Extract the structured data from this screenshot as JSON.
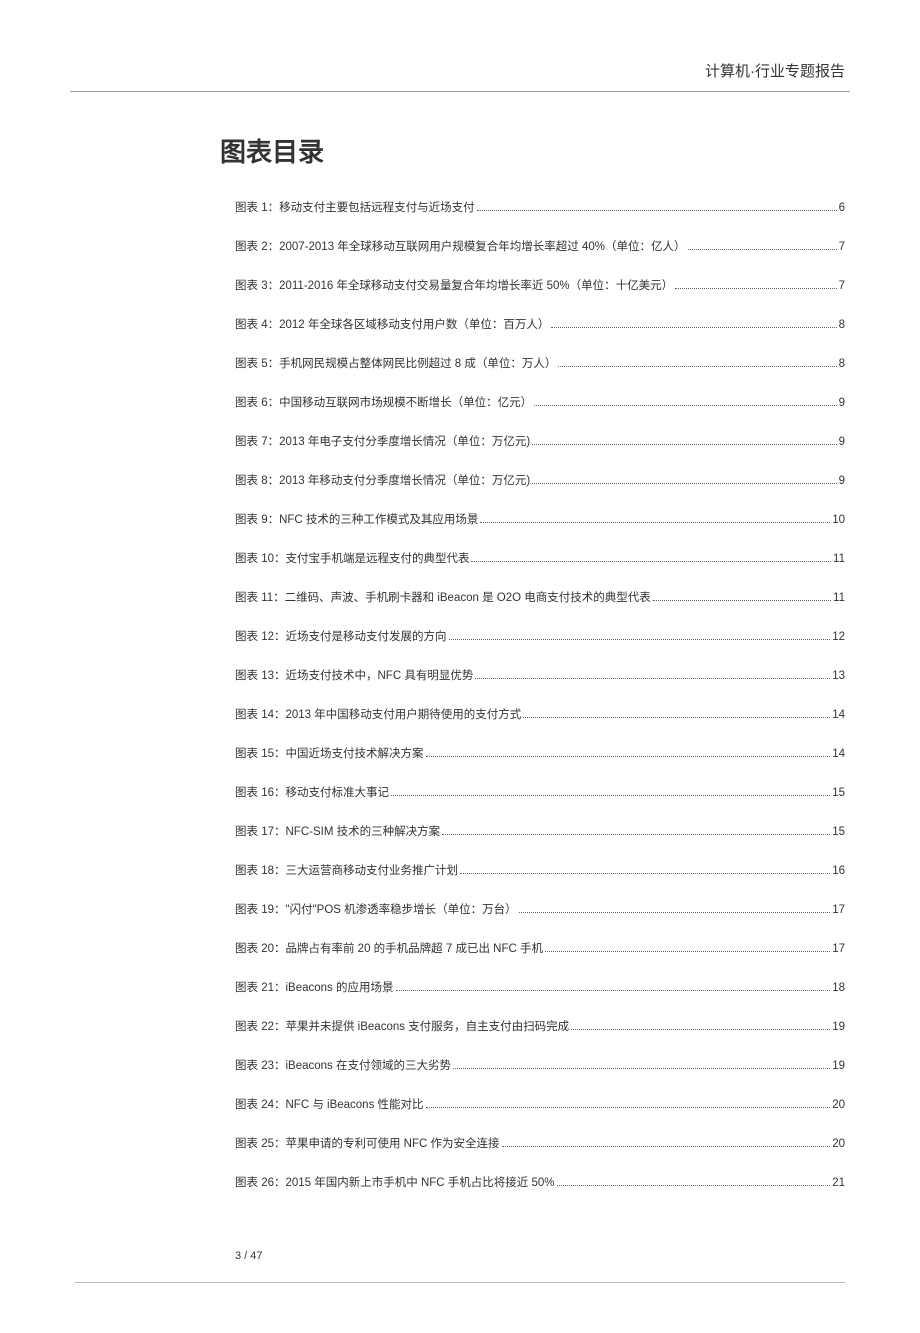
{
  "header_right": "计算机·行业专题报告",
  "toc_title": "图表目录",
  "entries": [
    {
      "text": "图表 1：移动支付主要包括远程支付与近场支付",
      "page": "6"
    },
    {
      "text": "图表 2：2007-2013 年全球移动互联网用户规模复合年均增长率超过 40%（单位：亿人）",
      "page": "7"
    },
    {
      "text": "图表 3：2011-2016 年全球移动支付交易量复合年均增长率近 50%（单位：十亿美元）",
      "page": "7"
    },
    {
      "text": "图表 4：2012 年全球各区域移动支付用户数（单位：百万人）",
      "page": "8"
    },
    {
      "text": "图表 5：手机网民规模占整体网民比例超过 8 成（单位：万人）",
      "page": "8"
    },
    {
      "text": "图表 6：中国移动互联网市场规模不断增长（单位：亿元）",
      "page": "9"
    },
    {
      "text": "图表 7：2013 年电子支付分季度增长情况（单位：万亿元)",
      "page": "9"
    },
    {
      "text": "图表 8：2013 年移动支付分季度增长情况（单位：万亿元)",
      "page": "9"
    },
    {
      "text": "图表 9：NFC 技术的三种工作模式及其应用场景",
      "page": "10"
    },
    {
      "text": "图表 10：支付宝手机端是远程支付的典型代表",
      "page": "11"
    },
    {
      "text": "图表 11：二维码、声波、手机刷卡器和 iBeacon 是 O2O 电商支付技术的典型代表",
      "page": "11"
    },
    {
      "text": "图表 12：近场支付是移动支付发展的方向",
      "page": "12"
    },
    {
      "text": "图表 13：近场支付技术中，NFC 具有明显优势",
      "page": "13"
    },
    {
      "text": "图表 14：2013 年中国移动支付用户期待使用的支付方式",
      "page": "14"
    },
    {
      "text": "图表 15：中国近场支付技术解决方案",
      "page": "14"
    },
    {
      "text": "图表 16：移动支付标准大事记",
      "page": "15"
    },
    {
      "text": "图表 17：NFC-SIM 技术的三种解决方案",
      "page": "15"
    },
    {
      "text": "图表 18：三大运营商移动支付业务推广计划",
      "page": "16"
    },
    {
      "text": "图表 19：\"闪付\"POS 机渗透率稳步增长（单位：万台）",
      "page": "17"
    },
    {
      "text": "图表 20：品牌占有率前 20 的手机品牌超 7 成已出 NFC 手机",
      "page": "17"
    },
    {
      "text": "图表 21：iBeacons 的应用场景",
      "page": "18"
    },
    {
      "text": "图表 22：苹果并未提供 iBeacons 支付服务，自主支付由扫码完成",
      "page": "19"
    },
    {
      "text": "图表 23：iBeacons 在支付领域的三大劣势",
      "page": "19"
    },
    {
      "text": "图表 24：NFC 与 iBeacons 性能对比",
      "page": "20"
    },
    {
      "text": "图表 25：苹果申请的专利可使用 NFC 作为安全连接",
      "page": "20"
    },
    {
      "text": "图表 26：2015 年国内新上市手机中 NFC 手机占比将接近 50%",
      "page": "21"
    }
  ],
  "page_number": "3 / 47"
}
